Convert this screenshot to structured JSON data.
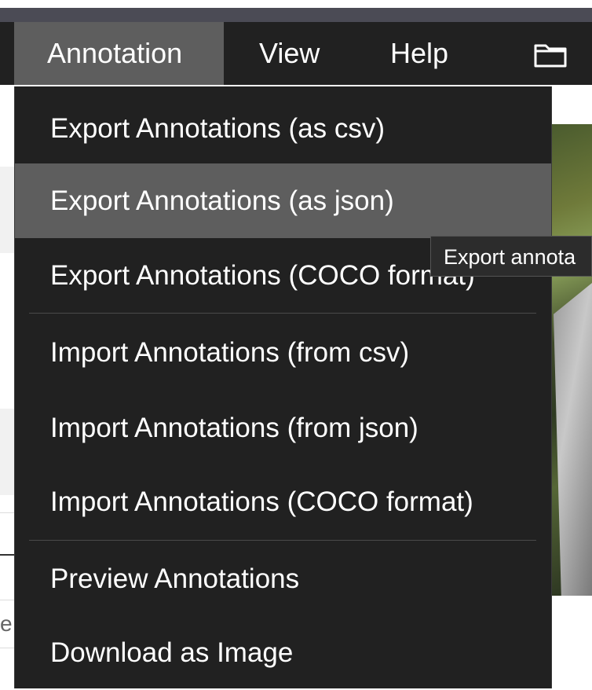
{
  "menubar": {
    "items": [
      {
        "label": "Annotation",
        "active": true
      },
      {
        "label": "View"
      },
      {
        "label": "Help"
      }
    ],
    "folder_icon": "folder-icon"
  },
  "dropdown": {
    "items": [
      {
        "label": "Export Annotations (as csv)"
      },
      {
        "label": "Export Annotations (as json)",
        "hovered": true
      },
      {
        "label": "Export Annotations (COCO format)"
      },
      {
        "label": "Import Annotations (from csv)"
      },
      {
        "label": "Import Annotations (from json)"
      },
      {
        "label": "Import Annotations (COCO format)"
      },
      {
        "label": "Preview Annotations"
      },
      {
        "label": "Download as Image"
      }
    ]
  },
  "tooltip": {
    "text": "Export annota"
  },
  "background": {
    "partial_letter": "e"
  },
  "colors": {
    "menubar_bg": "#212121",
    "active_bg": "#5e5e5e",
    "titlebar": "#4b4b55",
    "text": "#ffffff"
  }
}
